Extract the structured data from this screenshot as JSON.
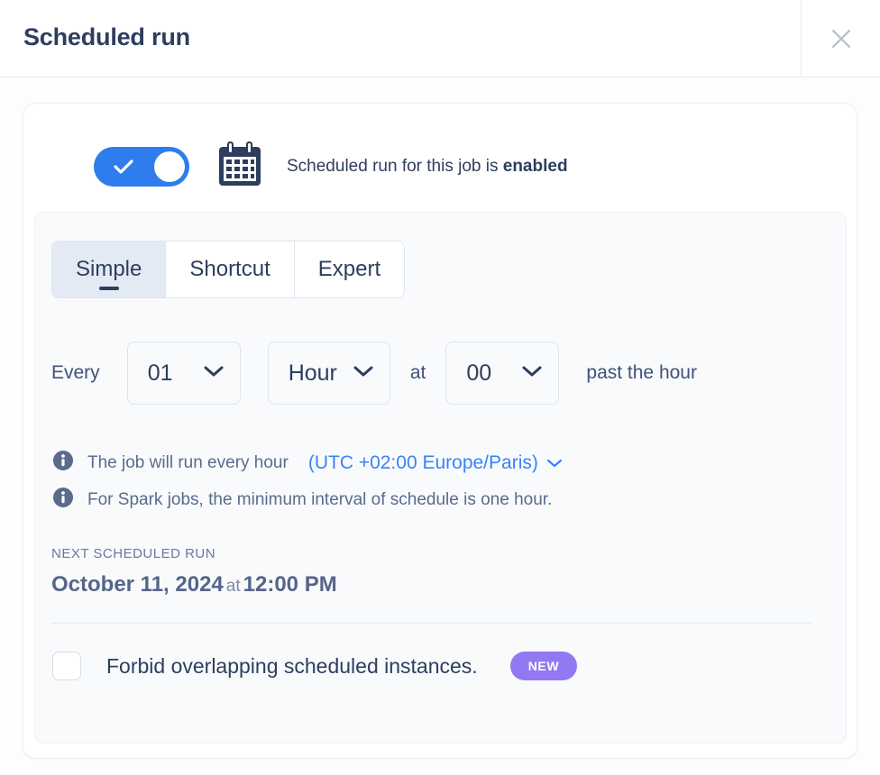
{
  "header": {
    "title": "Scheduled run",
    "close_icon": "close-icon"
  },
  "toggle": {
    "state": "on",
    "check_icon": "check-icon",
    "calendar_icon": "calendar-icon",
    "label_prefix": "Scheduled run for this job is ",
    "label_strong": "enabled",
    "color": "#2f7ced"
  },
  "tabs": [
    {
      "label": "Simple",
      "active": true
    },
    {
      "label": "Shortcut",
      "active": false
    },
    {
      "label": "Expert",
      "active": false
    }
  ],
  "schedule": {
    "every_label": "Every",
    "interval_value": "01",
    "unit_value": "Hour",
    "at_label": "at",
    "minute_value": "00",
    "suffix_label": "past the hour",
    "chevron_icon": "chevron-down-icon"
  },
  "info": {
    "icon": "info-icon",
    "line1": "The job will run every hour",
    "timezone": "(UTC +02:00 Europe/Paris)",
    "timezone_chevron": "chevron-down-icon",
    "timezone_color": "#3b82f6",
    "line2": "For Spark jobs, the minimum interval of schedule is one hour."
  },
  "next_run": {
    "label": "NEXT SCHEDULED RUN",
    "date": "October 11, 2024",
    "joiner": "at",
    "time": "12:00 PM"
  },
  "forbid_overlap": {
    "checked": false,
    "label": "Forbid overlapping scheduled instances.",
    "badge": "NEW",
    "badge_color": "#9279f2"
  }
}
